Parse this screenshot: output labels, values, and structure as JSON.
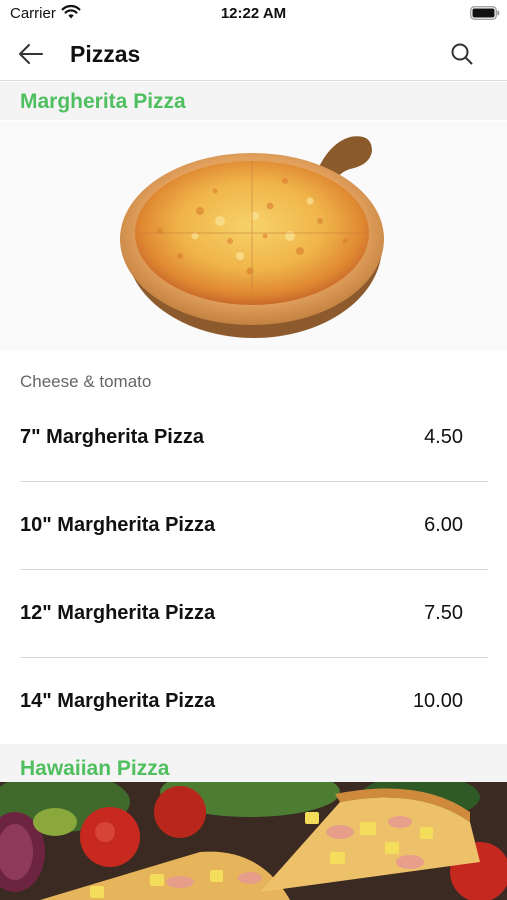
{
  "status_bar": {
    "carrier": "Carrier",
    "time": "12:22 AM"
  },
  "nav": {
    "title": "Pizzas",
    "back_icon": "arrow-left-icon",
    "search_icon": "search-icon"
  },
  "sections": [
    {
      "title": "Margherita Pizza",
      "description": "Cheese & tomato",
      "items": [
        {
          "name": "7\" Margherita Pizza",
          "price": "4.50"
        },
        {
          "name": "10\" Margherita Pizza",
          "price": "6.00"
        },
        {
          "name": "12\" Margherita Pizza",
          "price": "7.50"
        },
        {
          "name": "14\" Margherita Pizza",
          "price": "10.00"
        }
      ]
    },
    {
      "title": "Hawaiian Pizza"
    }
  ],
  "colors": {
    "accent": "#4fbf5f",
    "section_bg": "#f4f4f4",
    "divider": "#d8d8d8"
  }
}
